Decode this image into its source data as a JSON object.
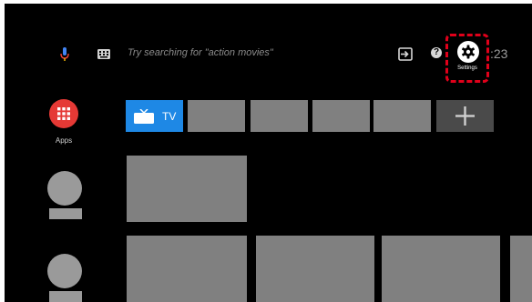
{
  "top_bar": {
    "mic_icon": "microphone-icon",
    "keyboard_icon": "keyboard-icon",
    "search_placeholder": "Try searching for \"action movies\"",
    "input_icon": "input-source-icon",
    "help_icon": "help-icon",
    "help_glyph": "?",
    "settings_label": "Settings",
    "clock": ":23"
  },
  "sidebar": {
    "apps_label": "Apps"
  },
  "favorites_row": {
    "tv_label": "TV",
    "add_icon": "plus-icon"
  },
  "colors": {
    "background": "#000000",
    "apps_red": "#e53935",
    "tv_blue": "#1e88e5",
    "placeholder_gray": "#808080",
    "add_tile_gray": "#4a4a4a",
    "highlight_red": "#e0001a"
  }
}
